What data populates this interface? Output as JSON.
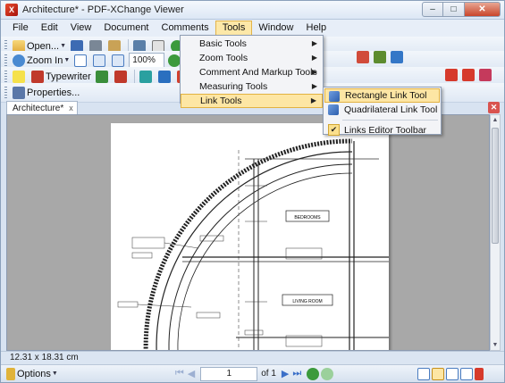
{
  "window": {
    "title": "Architecture* - PDF-XChange Viewer",
    "app_icon_letter": "X",
    "controls": {
      "minimize": "–",
      "maximize": "□",
      "close": "✕"
    }
  },
  "menubar": {
    "items": [
      {
        "id": "file",
        "label": "File"
      },
      {
        "id": "edit",
        "label": "Edit"
      },
      {
        "id": "view",
        "label": "View"
      },
      {
        "id": "document",
        "label": "Document"
      },
      {
        "id": "comments",
        "label": "Comments"
      },
      {
        "id": "tools",
        "label": "Tools",
        "active": true
      },
      {
        "id": "window",
        "label": "Window"
      },
      {
        "id": "help",
        "label": "Help"
      }
    ]
  },
  "toolbar1": {
    "open_label": "Open..."
  },
  "toolbar2": {
    "zoom_in_label": "Zoom In",
    "zoom_value": "100%"
  },
  "toolbar3": {
    "typewriter_label": "Typewriter"
  },
  "toolbar4": {
    "properties_label": "Properties..."
  },
  "tools_menu": {
    "items": [
      {
        "label": "Basic Tools",
        "has_submenu": true
      },
      {
        "label": "Zoom Tools",
        "has_submenu": true
      },
      {
        "label": "Comment And Markup Tools",
        "has_submenu": true
      },
      {
        "label": "Measuring Tools",
        "has_submenu": true
      },
      {
        "label": "Link Tools",
        "has_submenu": true,
        "highlighted": true
      }
    ]
  },
  "link_tools_submenu": {
    "items": [
      {
        "label": "Rectangle Link Tool",
        "icon": "rectangle-link-icon",
        "highlighted": true
      },
      {
        "label": "Quadrilateral Link Tool",
        "icon": "quadrilateral-link-icon"
      },
      {
        "label": "Links Editor Toolbar",
        "checked": true
      }
    ]
  },
  "document_tab": {
    "label": "Architecture*",
    "close_glyph": "x"
  },
  "drawing": {
    "room_labels": [
      "BEDROOMS",
      "LIVING ROOM"
    ]
  },
  "statusbar": {
    "dimensions": "12.31 x 18.31 cm"
  },
  "bottombar": {
    "options_label": "Options",
    "page_current": "1",
    "page_total": "of 1"
  },
  "colors": {
    "menu_highlight": "#fde6a4",
    "menu_highlight_border": "#e2b241",
    "workspace_bg": "#a8a8a8",
    "title_gradient_top": "#f4f8fd"
  }
}
